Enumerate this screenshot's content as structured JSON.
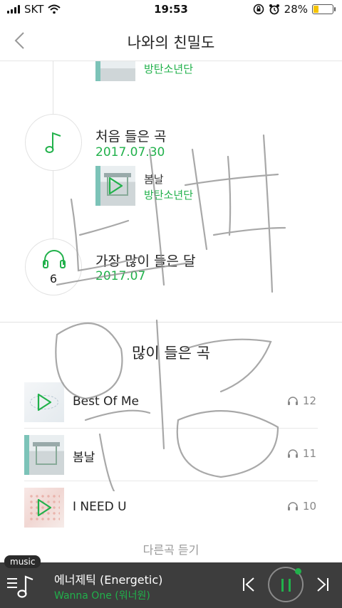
{
  "status": {
    "carrier": "SKT",
    "time": "19:53",
    "battery_percent": "28%",
    "battery_level": 0.28
  },
  "header": {
    "title": "나와의 친밀도"
  },
  "timeline": {
    "top_partial_artist": "방탄소년단",
    "first_song": {
      "title": "처음 들은 곡",
      "date": "2017.07.30",
      "song_name": "봄날",
      "song_artist": "방탄소년단"
    },
    "most_listened_month": {
      "title": "가장 많이 들은 달",
      "date": "2017.07",
      "count": "6"
    }
  },
  "most_played": {
    "title": "많이 들은 곡",
    "tracks": [
      {
        "name": "Best Of Me",
        "plays": "12"
      },
      {
        "name": "봄날",
        "plays": "11"
      },
      {
        "name": "I NEED U",
        "plays": "10"
      }
    ],
    "more_label": "다른곡 듣기"
  },
  "player": {
    "badge": "music",
    "song": "에너제틱 (Energetic)",
    "artist": "Wanna One (워너원)"
  },
  "colors": {
    "accent": "#21b14b",
    "player_bg": "#3d3d3d"
  }
}
